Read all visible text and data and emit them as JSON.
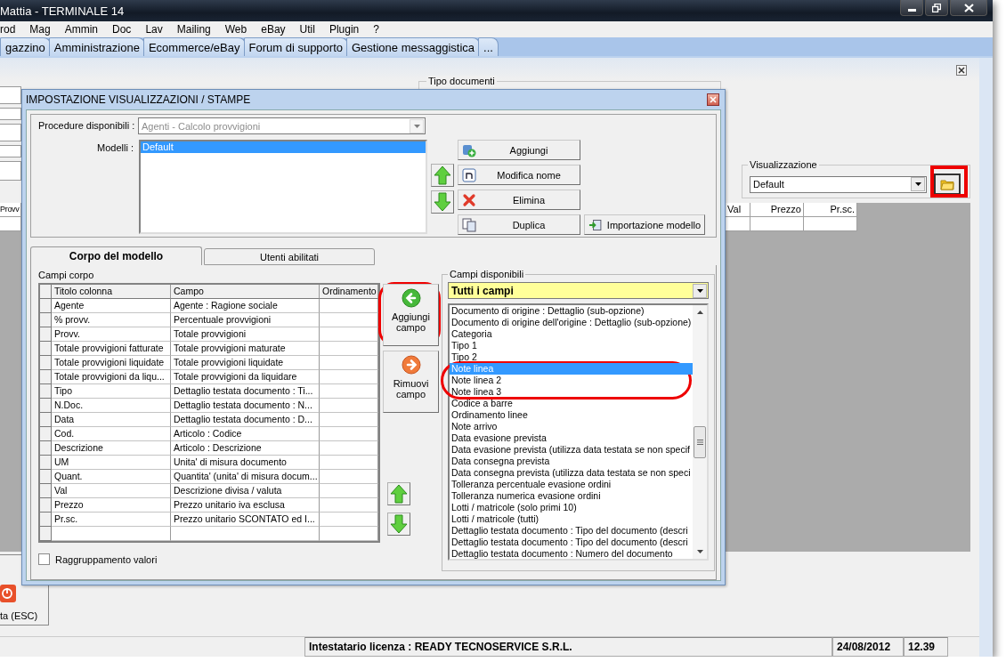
{
  "window": {
    "title": "Mattia - TERMINALE 14"
  },
  "menu": [
    "rod",
    "Mag",
    "Ammin",
    "Doc",
    "Lav",
    "Mailing",
    "Web",
    "eBay",
    "Util",
    "Plugin",
    "?"
  ],
  "tabs": [
    {
      "label": "gazzino",
      "selected": false
    },
    {
      "label": "Amministrazione",
      "selected": false
    },
    {
      "label": "Ecommerce/eBay",
      "selected": false
    },
    {
      "label": "Forum di supporto",
      "selected": false
    },
    {
      "label": "Gestione messaggistica",
      "selected": false
    },
    {
      "label": "...",
      "selected": false
    }
  ],
  "background": {
    "tipo_documenti": "Tipo documenti",
    "visualizzazione": {
      "label": "Visualizzazione",
      "value": "Default"
    },
    "grid_columns": [
      "Provv",
      "Val",
      "Prezzo",
      "Pr.sc."
    ],
    "exit_button": "ta (ESC)"
  },
  "dialog": {
    "title": "IMPOSTAZIONE VISUALIZZAZIONI / STAMPE",
    "procedure": {
      "label": "Procedure disponibili :",
      "value": "Agenti - Calcolo provvigioni",
      "disabled": true
    },
    "models": {
      "label": "Modelli :",
      "items": [
        {
          "label": "Default",
          "selected": true
        }
      ]
    },
    "model_buttons": [
      {
        "label": "Aggiungi",
        "kind": "add"
      },
      {
        "label": "Modifica nome",
        "kind": "rename"
      },
      {
        "label": "Elimina",
        "kind": "delete"
      },
      {
        "label": "Duplica",
        "kind": "copy"
      }
    ],
    "import_button": "Importazione modello",
    "tabs": [
      {
        "label": "Corpo del modello",
        "selected": true
      },
      {
        "label": "Utenti abilitati",
        "selected": false
      }
    ],
    "body_fields": {
      "label": "Campi corpo",
      "columns": [
        "Titolo colonna",
        "Campo",
        "Ordinamento"
      ],
      "rows": [
        {
          "title": "Agente",
          "field": "Agente : Ragione sociale"
        },
        {
          "title": "% provv.",
          "field": "Percentuale provvigioni"
        },
        {
          "title": "Provv.",
          "field": "Totale provvigioni"
        },
        {
          "title": "Totale provvigioni fatturate",
          "field": "Totale provvigioni maturate"
        },
        {
          "title": "Totale provvigioni liquidate",
          "field": "Totale provvigioni liquidate"
        },
        {
          "title": "Totale provvigioni da liqu...",
          "field": "Totale provvigioni da liquidare"
        },
        {
          "title": "Tipo",
          "field": "Dettaglio testata documento : Ti..."
        },
        {
          "title": "N.Doc.",
          "field": "Dettaglio testata documento : N..."
        },
        {
          "title": "Data",
          "field": "Dettaglio testata documento : D..."
        },
        {
          "title": "Cod.",
          "field": "Articolo : Codice"
        },
        {
          "title": "Descrizione",
          "field": "Articolo : Descrizione"
        },
        {
          "title": "UM",
          "field": "Unita' di misura documento"
        },
        {
          "title": "Quant.",
          "field": "Quantita' (unita' di misura docum..."
        },
        {
          "title": "Val",
          "field": "Descrizione divisa / valuta"
        },
        {
          "title": "Prezzo",
          "field": "Prezzo unitario iva esclusa"
        },
        {
          "title": "Pr.sc.",
          "field": "Prezzo unitario SCONTATO ed I..."
        }
      ]
    },
    "add_field_button": "Aggiungi campo",
    "remove_field_button": "Rimuovi campo",
    "grouping": {
      "label": "Raggruppamento valori",
      "checked": false
    },
    "available": {
      "label": "Campi disponibili",
      "filter": "Tutti i campi",
      "items": [
        {
          "label": "Documento di origine : Dettaglio (sub-opzione)",
          "selected": false
        },
        {
          "label": "Documento di origine dell'origine : Dettaglio (sub-opzione)",
          "selected": false
        },
        {
          "label": "Categoria",
          "selected": false
        },
        {
          "label": "Tipo 1",
          "selected": false
        },
        {
          "label": "Tipo 2",
          "selected": false
        },
        {
          "label": "Note linea",
          "selected": true
        },
        {
          "label": "Note linea 2",
          "selected": false
        },
        {
          "label": "Note linea 3",
          "selected": false
        },
        {
          "label": "Codice a barre",
          "selected": false
        },
        {
          "label": "Ordinamento linee",
          "selected": false
        },
        {
          "label": "Note arrivo",
          "selected": false
        },
        {
          "label": "Data evasione prevista",
          "selected": false
        },
        {
          "label": "Data evasione prevista (utilizza data testata se non specif",
          "selected": false
        },
        {
          "label": "Data consegna prevista",
          "selected": false
        },
        {
          "label": "Data consegna prevista (utilizza data testata se non speci",
          "selected": false
        },
        {
          "label": "Tolleranza percentuale evasione ordini",
          "selected": false
        },
        {
          "label": "Tolleranza numerica evasione ordini",
          "selected": false
        },
        {
          "label": "Lotti / matricole (solo primi 10)",
          "selected": false
        },
        {
          "label": "Lotti / matricole (tutti)",
          "selected": false
        },
        {
          "label": "Dettaglio testata documento : Tipo del documento (descri",
          "selected": false
        },
        {
          "label": "Dettaglio testata documento : Tipo del documento (descri",
          "selected": false
        },
        {
          "label": "Dettaglio testata documento : Numero del documento",
          "selected": false
        }
      ]
    }
  },
  "status_bar": {
    "license": "Intestatario licenza : READY TECNOSERVICE S.R.L.",
    "date": "24/08/2012",
    "time": "12.39"
  }
}
